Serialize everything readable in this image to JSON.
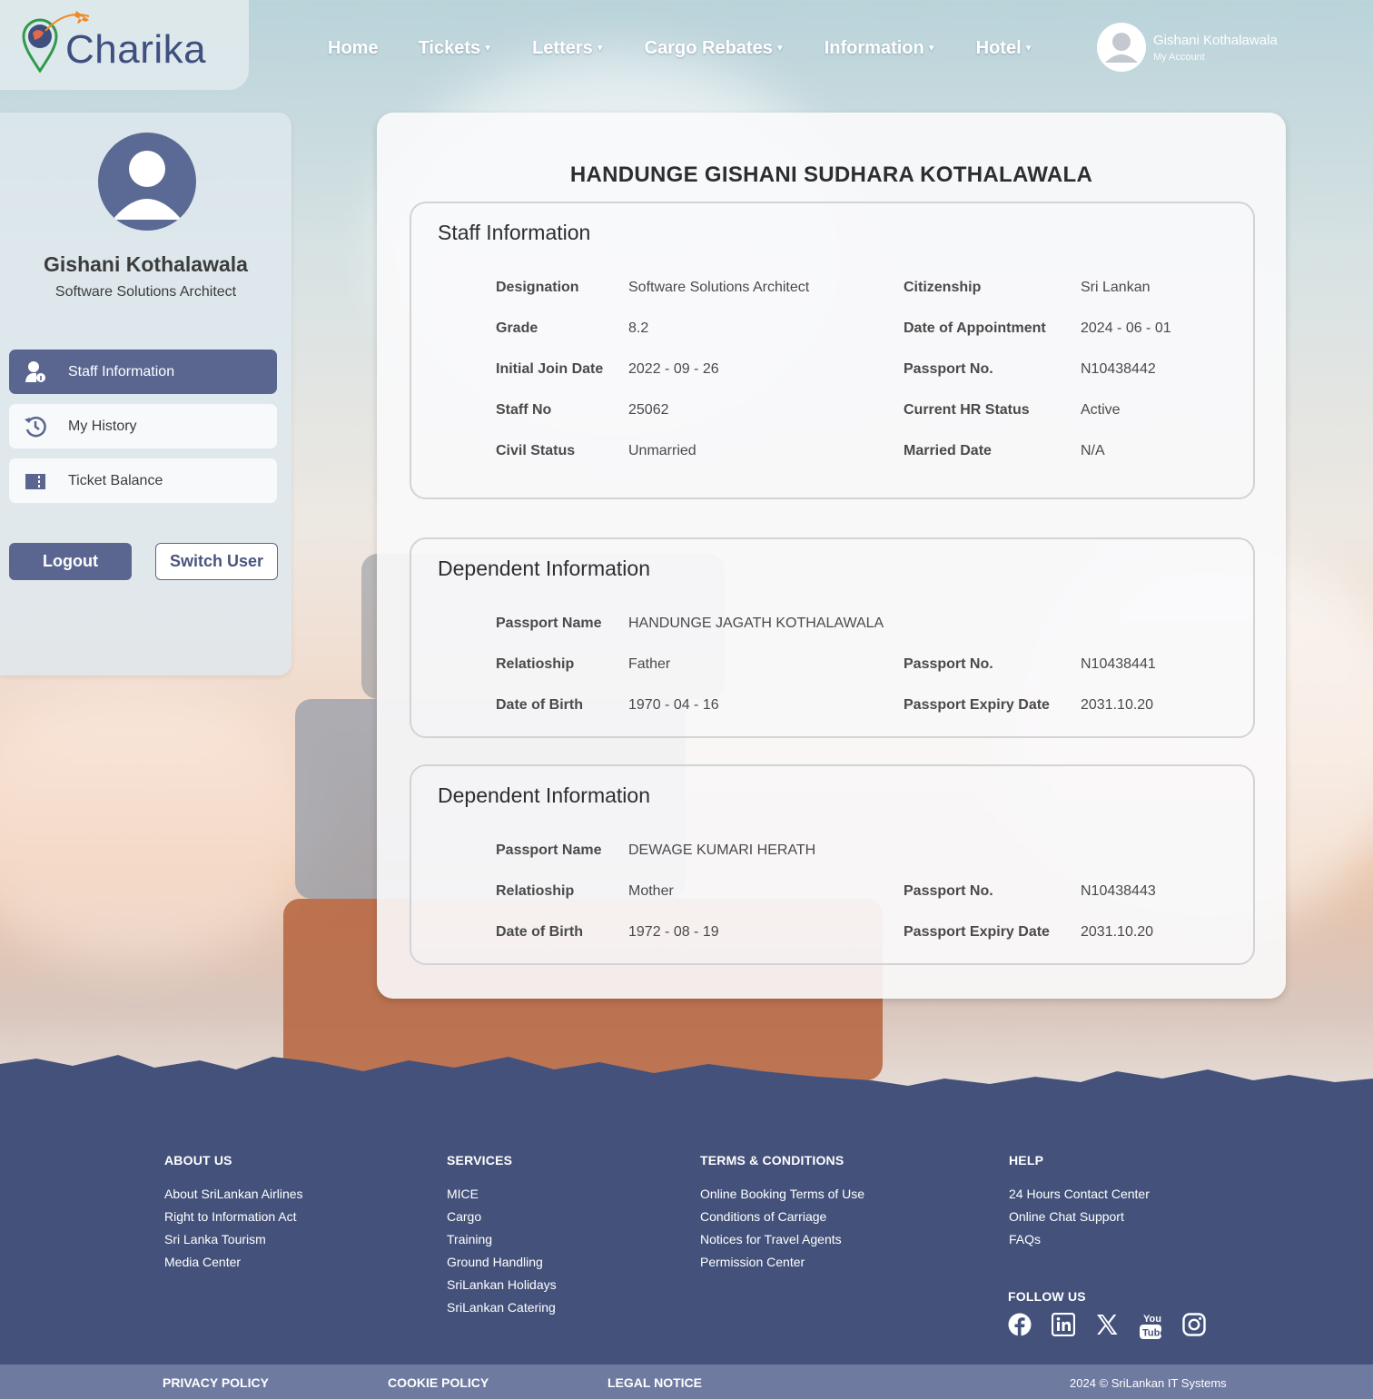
{
  "brand": {
    "name": "Charika"
  },
  "nav": [
    {
      "label": "Home",
      "dropdown": false
    },
    {
      "label": "Tickets",
      "dropdown": true
    },
    {
      "label": "Letters",
      "dropdown": true
    },
    {
      "label": "Cargo Rebates",
      "dropdown": true
    },
    {
      "label": "Information",
      "dropdown": true
    },
    {
      "label": "Hotel",
      "dropdown": true
    }
  ],
  "account": {
    "name": "Gishani Kothalawala",
    "sub": "My Account"
  },
  "sidebar": {
    "name": "Gishani Kothalawala",
    "role": "Software Solutions Architect",
    "items": [
      {
        "label": "Staff Information",
        "icon": "user-info-icon",
        "active": true
      },
      {
        "label": "My History",
        "icon": "history-icon",
        "active": false
      },
      {
        "label": "Ticket Balance",
        "icon": "ticket-icon",
        "active": false
      }
    ],
    "logout": "Logout",
    "switch_user": "Switch User"
  },
  "main": {
    "title": "HANDUNGE GISHANI SUDHARA KOTHALAWALA",
    "staff": {
      "title": "Staff Information",
      "left": [
        {
          "label": "Designation",
          "value": "Software Solutions Architect"
        },
        {
          "label": "Grade",
          "value": "8.2"
        },
        {
          "label": "Initial Join Date",
          "value": "2022 - 09 - 26"
        },
        {
          "label": "Staff No",
          "value": "25062"
        },
        {
          "label": "Civil Status",
          "value": "Unmarried"
        }
      ],
      "right": [
        {
          "label": "Citizenship",
          "value": "Sri Lankan"
        },
        {
          "label": "Date of Appointment",
          "value": "2024 - 06 - 01"
        },
        {
          "label": "Passport No.",
          "value": "N10438442"
        },
        {
          "label": "Current HR Status",
          "value": "Active"
        },
        {
          "label": "Married Date",
          "value": "N/A"
        }
      ]
    },
    "dependents": [
      {
        "title": "Dependent Information",
        "passport_name_label": "Passport Name",
        "passport_name": "HANDUNGE JAGATH KOTHALAWALA",
        "relationship_label": "Relatioship",
        "relationship": "Father",
        "dob_label": "Date of Birth",
        "dob": "1970 - 04 - 16",
        "passport_no_label": "Passport No.",
        "passport_no": "N10438441",
        "expiry_label": "Passport Expiry Date",
        "expiry": "2031.10.20"
      },
      {
        "title": "Dependent Information",
        "passport_name_label": "Passport Name",
        "passport_name": "DEWAGE KUMARI HERATH",
        "relationship_label": "Relatioship",
        "relationship": "Mother",
        "dob_label": "Date of Birth",
        "dob": "1972 - 08 - 19",
        "passport_no_label": "Passport No.",
        "passport_no": "N10438443",
        "expiry_label": "Passport Expiry Date",
        "expiry": "2031.10.20"
      }
    ]
  },
  "footer": {
    "about": {
      "head": "ABOUT US",
      "links": [
        "About SriLankan Airlines",
        "Right to Information Act",
        "Sri Lanka Tourism",
        "Media Center"
      ]
    },
    "services": {
      "head": "SERVICES",
      "links": [
        "MICE",
        "Cargo",
        "Training",
        "Ground Handling",
        "SriLankan Holidays",
        "SriLankan Catering"
      ]
    },
    "terms": {
      "head": "TERMS & CONDITIONS",
      "links": [
        "Online Booking Terms of Use",
        "Conditions of Carriage",
        "Notices for Travel Agents",
        "Permission Center"
      ]
    },
    "help": {
      "head": "HELP",
      "links": [
        "24 Hours Contact Center",
        "Online Chat Support",
        "FAQs"
      ]
    },
    "follow": {
      "head": "FOLLOW US",
      "icons": [
        "facebook-icon",
        "linkedin-icon",
        "x-icon",
        "youtube-icon",
        "instagram-icon"
      ]
    },
    "bottom": {
      "privacy": "PRIVACY POLICY",
      "cookie": "COOKIE POLICY",
      "legal": "LEGAL NOTICE",
      "copyright": "2024 © SriLankan IT Systems"
    }
  },
  "colors": {
    "primary": "#5a6690",
    "footer": "#44527b",
    "bottom_bar": "#6f7aa1",
    "accent_orange": "#f08a24"
  }
}
